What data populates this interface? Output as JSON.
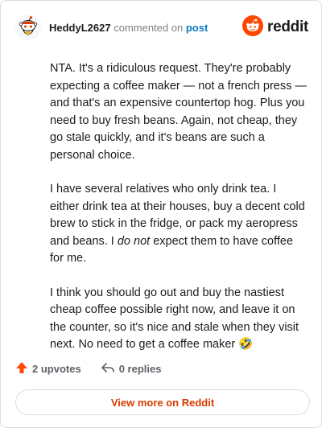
{
  "header": {
    "username": "HeddyL2627",
    "action_text": "commented on",
    "post_link": "post",
    "brand": "reddit"
  },
  "comment": {
    "p1": "NTA. It's a ridiculous request. They're probably expecting a coffee maker — not a french press — and that's an expensive countertop hog. Plus you need to buy fresh beans. Again, not cheap, they go stale quickly, and it's beans are such a personal choice.",
    "p2_before": "I have several relatives who only drink tea. I either drink tea at their houses, buy a decent cold brew to stick in the fridge, or pack my aeropress and beans. I ",
    "p2_emphasis": "do not",
    "p2_after": " expect them to have coffee for me.",
    "p3": "I think you should go out and buy the nastiest cheap coffee possible right now, and leave it on the counter, so it's nice and stale when they visit next. No need to get a coffee maker",
    "p3_emoji": "🤣"
  },
  "footer": {
    "upvotes": "2 upvotes",
    "replies": "0 replies"
  },
  "cta": {
    "label": "View more on Reddit"
  },
  "colors": {
    "reddit_orange": "#ff4500",
    "link_blue": "#0a7bc4",
    "cta_text": "#d93a00",
    "muted": "#7c8186"
  },
  "icons": [
    "snoo-avatar-icon",
    "reddit-logo-icon",
    "upvote-arrow-icon",
    "reply-arrow-icon"
  ]
}
